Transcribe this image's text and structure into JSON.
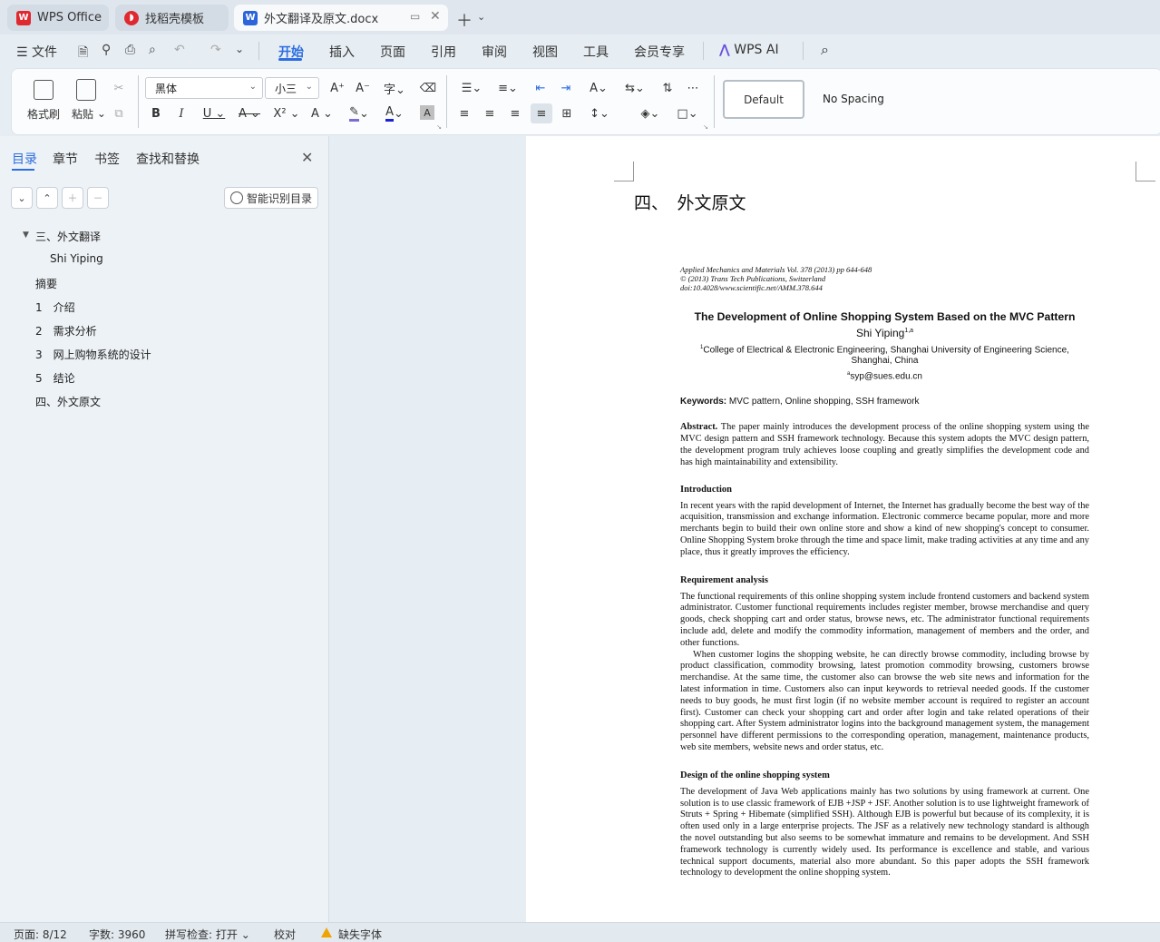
{
  "tabs": [
    {
      "label": "WPS Office",
      "icon": "wps-logo-icon"
    },
    {
      "label": "找稻壳模板",
      "icon": "docer-logo-icon"
    },
    {
      "label": "外文翻译及原文.docx",
      "icon": "word-doc-icon"
    }
  ],
  "menu": {
    "file": "文件",
    "items": [
      "开始",
      "插入",
      "页面",
      "引用",
      "审阅",
      "视图",
      "工具",
      "会员专享"
    ],
    "ai": "WPS AI"
  },
  "ribbon": {
    "format_painter": "格式刷",
    "paste": "粘贴",
    "font_name": "黑体",
    "font_size": "小三",
    "style_default": "Default",
    "style_nospacing": "No Spacing"
  },
  "nav": {
    "tabs": [
      "目录",
      "章节",
      "书签",
      "查找和替换"
    ],
    "smart_toc": "智能识别目录",
    "toc": [
      "三、外文翻译",
      "Shi Yiping",
      "摘要",
      "1　介绍",
      "2　需求分析",
      "3　网上购物系统的设计",
      "5　结论",
      "四、外文原文"
    ]
  },
  "doc": {
    "heading": "四、　外文原文",
    "paper": {
      "meta1": "Applied Mechanics and Materials Vol. 378 (2013) pp 644-648",
      "meta2": "© (2013) Trans Tech Publications, Switzerland",
      "meta3": "doi:10.4028/www.scientific.net/AMM.378.644",
      "title": "The Development of Online Shopping System Based on the MVC Pattern",
      "author": "Shi Yiping",
      "author_sup": "1,a",
      "affil_sup": "1",
      "affiliation": "College of Electrical & Electronic Engineering, Shanghai University of Engineering Science, Shanghai, China",
      "email_sup": "a",
      "email": "syp@sues.edu.cn",
      "keywords_label": "Keywords:",
      "keywords": "MVC pattern, Online shopping, SSH framework",
      "abstract_label": "Abstract.",
      "abstract": "The paper mainly introduces the development process of the online shopping system using the MVC design pattern and SSH framework technology. Because this system adopts the MVC design pattern, the development program truly achieves loose coupling and greatly simplifies the development code and has high maintainability and extensibility.",
      "intro_title": "Introduction",
      "intro": "In recent years with the rapid development of Internet, the Internet has gradually become the best way of the acquisition, transmission and exchange information. Electronic commerce became popular, more and more merchants begin to build their own online store and show a kind of new shopping's concept to consumer. Online Shopping System broke through the time and space limit, make trading activities at any time and any place, thus it greatly improves the efficiency.",
      "req_title": "Requirement analysis",
      "req1": "The functional requirements of this online shopping system include frontend customers and backend system administrator. Customer functional requirements includes register member, browse merchandise and query goods, check shopping cart and order status, browse news, etc. The administrator functional requirements include add, delete and modify the commodity information, management of members and the order, and other functions.",
      "req2": "When customer logins the shopping website, he can directly browse commodity, including browse by product classification, commodity browsing, latest promotion commodity browsing, customers browse merchandise. At the same time, the customer also can browse the web site news and information for the latest information in time. Customers also can input keywords to retrieval needed goods. If the customer needs to buy goods, he must first login (if no website member account is required to register an account first). Customer can check your shopping cart and order after login and take related operations of their shopping cart. After System administrator logins into the background management system, the management personnel have different permissions to the corresponding operation, management, maintenance products, web site members, website news and order status, etc.",
      "design_title": "Design of the online shopping system",
      "design": "The development of Java Web applications mainly has two solutions by using framework at current. One solution is to use classic framework of EJB +JSP + JSF. Another solution is to use lightweight framework of Struts + Spring + Hibemate (simplified SSH). Although EJB is powerful but because of its complexity, it is often used only in a large enterprise projects. The JSF as a relatively new technology standard is although the novel outstanding but also seems to be somewhat immature and remains to be development. And SSH framework technology is currently widely used. Its performance is excellence and stable, and various technical support documents, material also more abundant. So this paper adopts the SSH framework technology to development the online shopping system."
    }
  },
  "status": {
    "page": "页面: 8/12",
    "words": "字数: 3960",
    "spell": "拼写检查: 打开",
    "proof": "校对",
    "missing_font": "缺失字体"
  },
  "colors": {
    "accent": "#2c6ee0",
    "wps_red": "#e0282f",
    "word_blue": "#2b65d9",
    "warning": "#f0a400"
  }
}
